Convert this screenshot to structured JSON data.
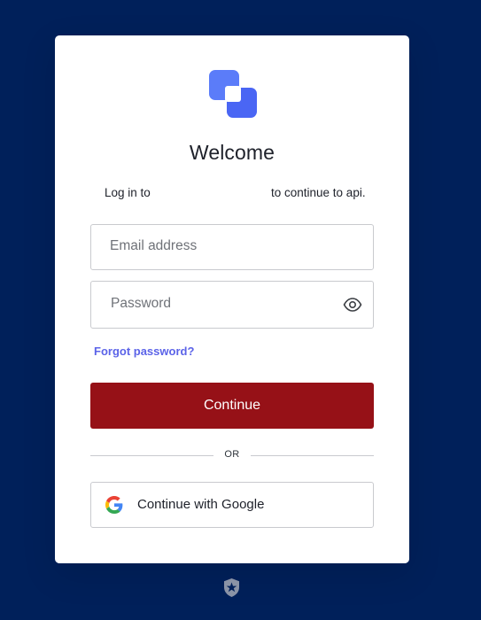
{
  "colors": {
    "page_background": "#00205a",
    "card_background": "#ffffff",
    "primary_button": "#961117",
    "link": "#5b63e8",
    "logo_accent": "#4f6ef7"
  },
  "logo": {
    "icon": "brand-logo-icon"
  },
  "header": {
    "title": "Welcome",
    "subtitle_prefix": "Log in to",
    "subtitle_suffix": "to continue to api."
  },
  "form": {
    "email_placeholder": "Email address",
    "password_placeholder": "Password",
    "password_toggle_icon": "eye-icon",
    "forgot_password": "Forgot password?",
    "continue_label": "Continue"
  },
  "divider": {
    "label": "OR"
  },
  "social": {
    "google_label": "Continue with Google",
    "google_icon": "google-icon"
  },
  "footer": {
    "icon": "shield-star-icon"
  }
}
